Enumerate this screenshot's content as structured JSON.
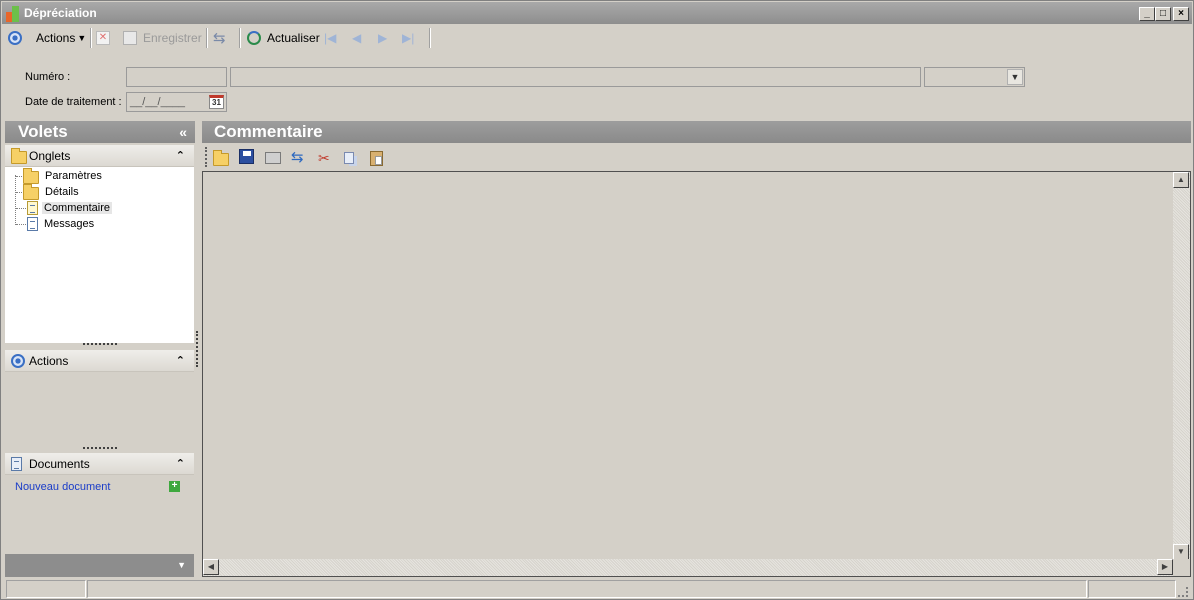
{
  "window": {
    "title": "Dépréciation",
    "controls": {
      "minimize": "_",
      "maximize": "□",
      "close": "×"
    }
  },
  "toolbar": {
    "actions_label": "Actions",
    "save_label": "Enregistrer",
    "refresh_label": "Actualiser"
  },
  "form": {
    "numero_label": "Numéro :",
    "numero_value": "",
    "description_value": "",
    "select_value": "",
    "date_label": "Date de traitement :",
    "date_value": "__/__/____",
    "calendar_day": "31"
  },
  "left_pane": {
    "title": "Volets",
    "collapse_glyph": "«",
    "sections": {
      "onglets": {
        "title": "Onglets",
        "items": [
          {
            "label": "Paramètres",
            "icon": "folder-icon"
          },
          {
            "label": "Détails",
            "icon": "folder-icon"
          },
          {
            "label": "Commentaire",
            "icon": "document-icon",
            "selected": true
          },
          {
            "label": "Messages",
            "icon": "document-icon"
          }
        ]
      },
      "actions": {
        "title": "Actions"
      },
      "documents": {
        "title": "Documents",
        "new_document": "Nouveau document"
      }
    }
  },
  "content": {
    "title": "Commentaire",
    "editor_toolbar": [
      "open-icon",
      "save-icon",
      "print-icon",
      "refresh-icon",
      "cut-icon",
      "copy-icon",
      "paste-icon"
    ],
    "body_text": ""
  },
  "colors": {
    "window_bg": "#d4d0c8",
    "pane_header": "#8e8e8e",
    "link": "#1a3cc8",
    "accent_blue": "#3a6fc4"
  }
}
